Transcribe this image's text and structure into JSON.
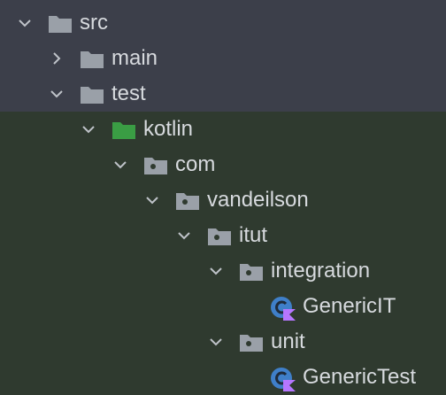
{
  "tree": {
    "items": [
      {
        "label": "src",
        "icon": "folder-icon"
      },
      {
        "label": "main",
        "icon": "folder-icon"
      },
      {
        "label": "test",
        "icon": "folder-icon"
      },
      {
        "label": "kotlin",
        "icon": "test-source-folder-icon"
      },
      {
        "label": "com",
        "icon": "package-icon"
      },
      {
        "label": "vandeilson",
        "icon": "package-icon"
      },
      {
        "label": "itut",
        "icon": "package-icon"
      },
      {
        "label": "integration",
        "icon": "package-icon"
      },
      {
        "label": "GenericIT",
        "icon": "kotlin-class-icon"
      },
      {
        "label": "unit",
        "icon": "package-icon"
      },
      {
        "label": "GenericTest",
        "icon": "kotlin-class-icon"
      }
    ]
  },
  "colors": {
    "header_background": "#3c3f4a",
    "body_background": "#2f3a2f",
    "folder": "#9aa0a8",
    "test_folder": "#3a9d44",
    "kotlin_class": "#3f7fc9",
    "kotlin_badge": "#b676ff",
    "text": "#d7dade"
  }
}
